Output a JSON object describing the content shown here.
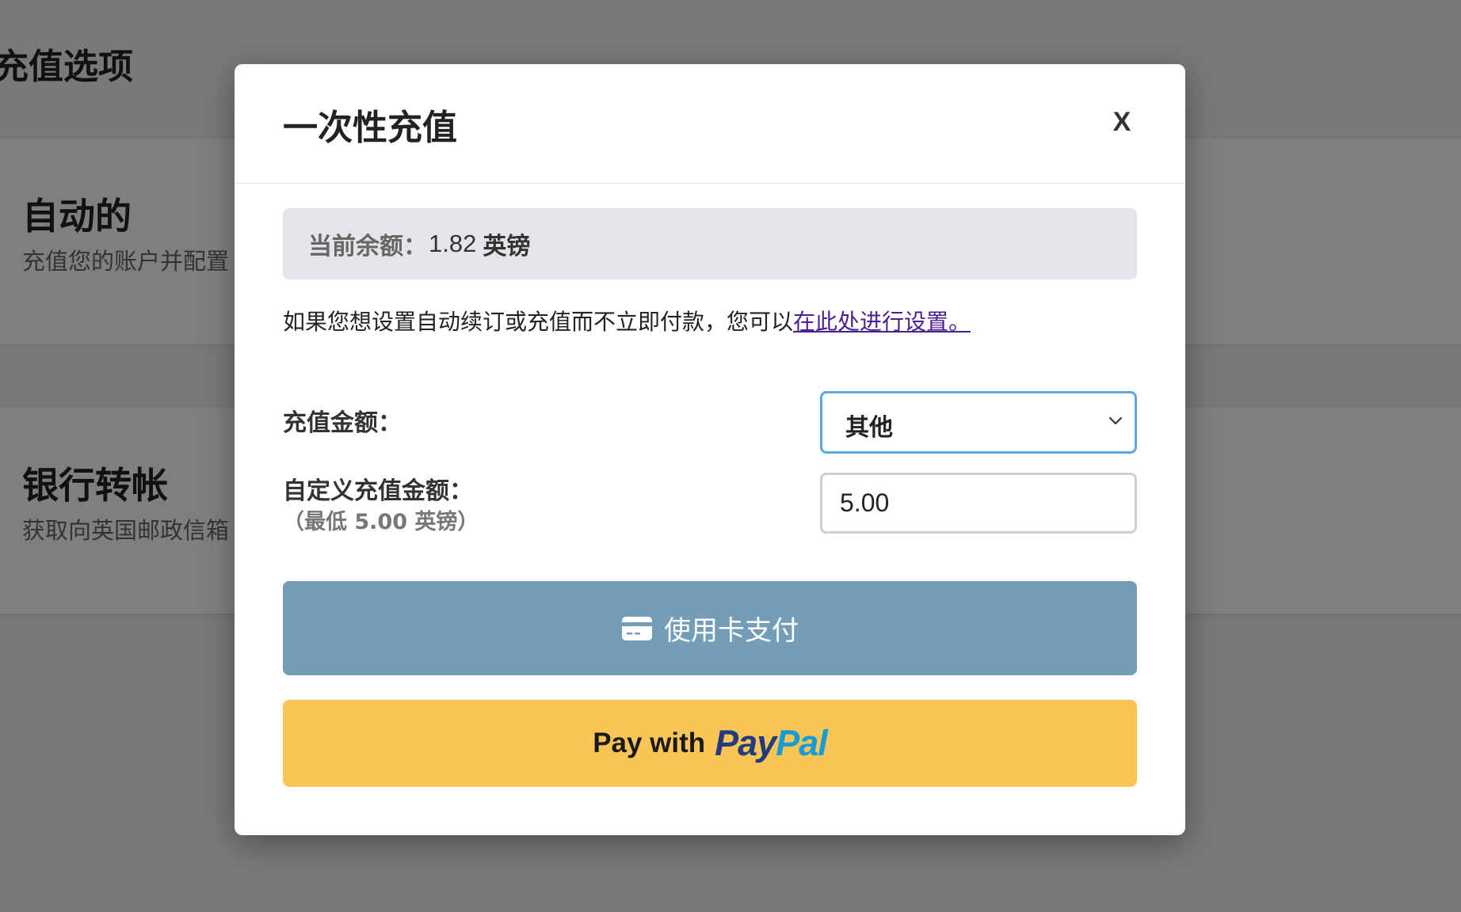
{
  "background": {
    "heading": "充值选项",
    "cards": [
      {
        "title": "自动的",
        "description": "充值您的账户并配置"
      },
      {
        "title": "银行转帐",
        "description": "获取向英国邮政信箱"
      }
    ]
  },
  "modal": {
    "title": "一次性充值",
    "close_label": "X",
    "balance": {
      "label": "当前余额：",
      "amount": "1.82",
      "currency": "英镑"
    },
    "info_text": "如果您想设置自动续订或充值而不立即付款，您可以",
    "info_link": "在此处进行设置。",
    "amount_label": "充值金额：",
    "amount_select_value": "其他",
    "custom_amount_label": "自定义充值金额：",
    "custom_amount_min": "（最低 5.00 英镑）",
    "custom_amount_value": "5.00",
    "card_button_label": "使用卡支付",
    "paypal": {
      "prefix": "Pay with",
      "logo_pay": "Pay",
      "logo_pal": "Pal"
    }
  },
  "colors": {
    "overlay": "rgba(0,0,0,0.5)",
    "card_button": "#749eb8",
    "paypal_button": "#f8c556",
    "link": "#4b1f8e",
    "select_border": "#5aa9e2"
  },
  "icons": {
    "close": "close-icon",
    "dropdown": "chevron-down-icon",
    "card": "credit-card-icon"
  }
}
